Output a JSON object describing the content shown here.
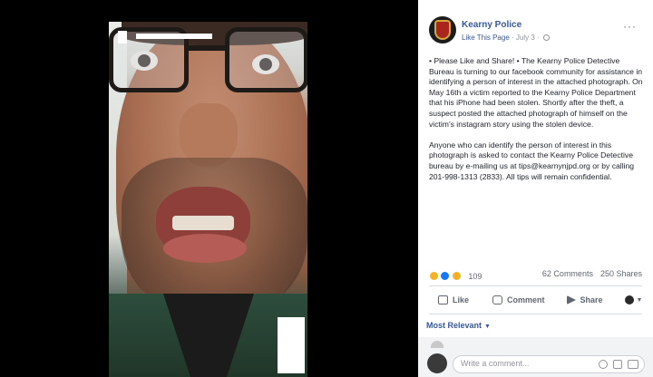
{
  "post": {
    "page_name": "Kearny Police",
    "like_link": "Like This Page",
    "date": " · July 3 · ",
    "paragraphs": [
      "• Please Like and Share! • The Kearny Police Detective Bureau is turning to our facebook community for assistance in identifying a person of interest in the attached photograph. On May 16th a victim reported to the Kearny Police Department that his iPhone had been stolen. Shortly after the theft, a suspect posted the attached photograph of himself on the victim's instagram story using the stolen device.",
      "Anyone who can identify the person of interest in this photograph is asked to contact the Kearny Police Detective bureau by e-mailing us at tips@kearnynjpd.org or by calling 201-998-1313 (2833). All tips will remain confidential."
    ],
    "more_icon": "···"
  },
  "stats": {
    "reaction_count": "109",
    "comments": "62 Comments",
    "shares": "250 Shares"
  },
  "actions": {
    "like": "Like",
    "comment": "Comment",
    "share": "Share"
  },
  "sort": {
    "label": "Most Relevant"
  },
  "comment_input": {
    "placeholder": "Write a comment..."
  },
  "icons": [
    "police-badge-icon",
    "globe-icon",
    "more-icon",
    "haha-icon",
    "like-icon",
    "wow-icon",
    "like-thumb-icon",
    "comment-bubble-icon",
    "share-arrow-icon",
    "emoji-icon",
    "camera-icon",
    "gif-icon"
  ],
  "colors": {
    "link": "#385898",
    "text": "#1d2129",
    "muted": "#606770"
  }
}
